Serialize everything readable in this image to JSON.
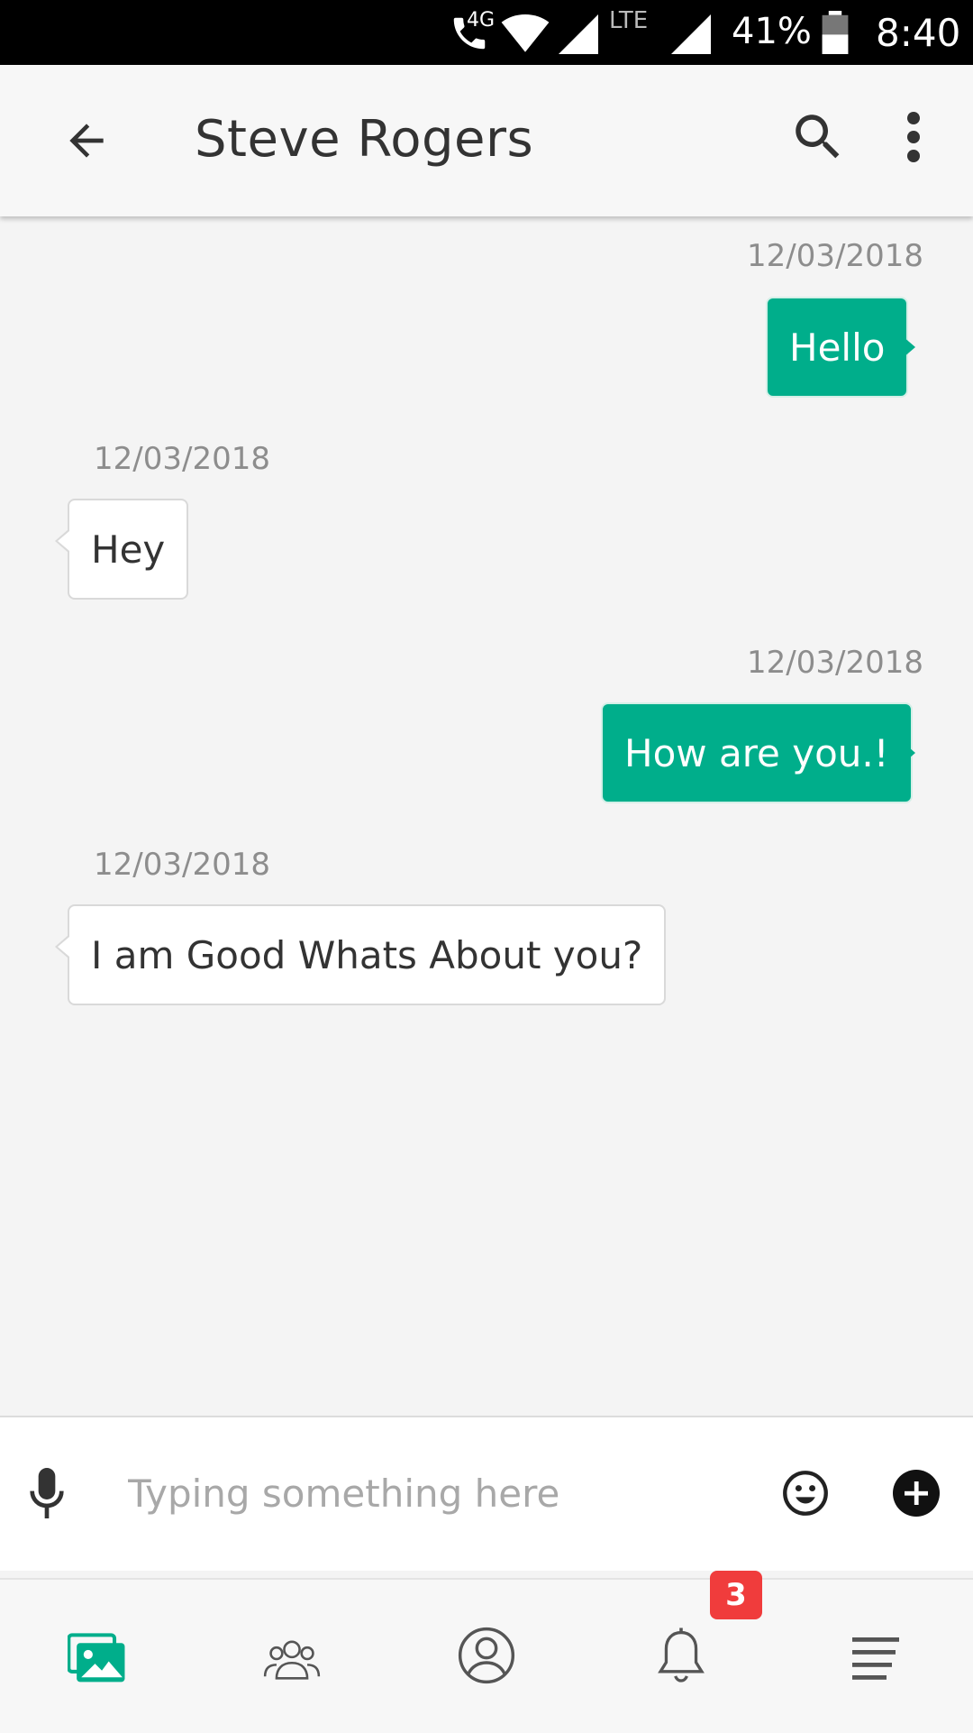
{
  "status_bar": {
    "network_label": "4G",
    "lte_label": "LTE",
    "battery": "41%",
    "time": "8:40"
  },
  "header": {
    "title": "Steve Rogers"
  },
  "messages": [
    {
      "direction": "out",
      "date": "12/03/2018",
      "text": "Hello"
    },
    {
      "direction": "in",
      "date": "12/03/2018",
      "text": "Hey"
    },
    {
      "direction": "out",
      "date": "12/03/2018",
      "text": "How are you.!"
    },
    {
      "direction": "in",
      "date": "12/03/2018",
      "text": "I am Good Whats About you?"
    }
  ],
  "composer": {
    "placeholder": "Typing something here"
  },
  "bottom_nav": {
    "items": [
      "gallery-icon",
      "groups-icon",
      "profile-icon",
      "notifications-icon",
      "menu-icon"
    ],
    "notification_count": "3"
  },
  "colors": {
    "accent": "#00ae8b",
    "badge": "#f03c3c"
  }
}
